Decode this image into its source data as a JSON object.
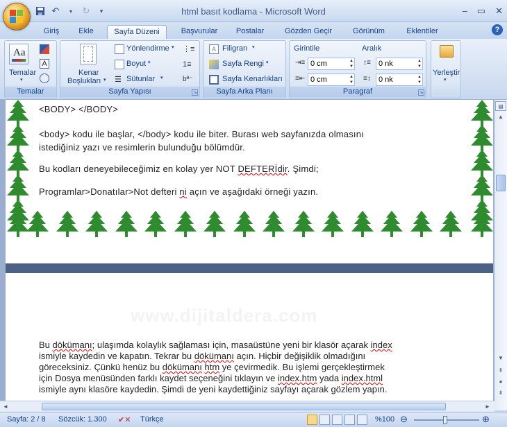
{
  "window": {
    "title": "html basıt kodlama - Microsoft Word",
    "controls": [
      "–",
      "▭",
      "✕"
    ]
  },
  "tabs": [
    "Giriş",
    "Ekle",
    "Sayfa Düzeni",
    "Başvurular",
    "Postalar",
    "Gözden Geçir",
    "Görünüm",
    "Eklentiler"
  ],
  "active_tab": "Sayfa Düzeni",
  "ribbon": {
    "temalar": {
      "label": "Temalar",
      "button": "Temalar"
    },
    "sayfa_yapisi": {
      "label": "Sayfa Yapısı",
      "kenar": "Kenar",
      "bosluklari": "Boşlukları",
      "yonlendirme": "Yönlendirme",
      "boyut": "Boyut",
      "sutunlar": "Sütunlar"
    },
    "sayfa_arka_plani": {
      "label": "Sayfa Arka Planı",
      "filigran": "Filigran",
      "sayfa_rengi": "Sayfa Rengi",
      "sayfa_kenarliklari": "Sayfa Kenarlıkları"
    },
    "paragraf": {
      "label": "Paragraf",
      "girintile": "Girintile",
      "aralik": "Aralık",
      "indent_left": "0 cm",
      "indent_right": "0 cm",
      "space_before": "0 nk",
      "space_after": "0 nk"
    },
    "yerlestir": {
      "label": "Yerleştir"
    }
  },
  "document": {
    "page1": {
      "l1": "<BODY> </BODY>",
      "l2": "<body> kodu ile başlar, </body> kodu ile biter. Burası web sayfanızda olmasını",
      "l3": "istediğiniz  yazı ve resimlerin bulunduğu bölümdür.",
      "l4a": "Bu kodları deneyebileceğimiz  en kolay yer NOT ",
      "l4b": "DEFTERİdir",
      "l4c": ". Şimdi;",
      "l5a": "Programlar>Donatılar>Not defteri ",
      "l5b": "ni",
      "l5c": " açın ve aşağıdaki örneği yazın."
    },
    "page2": {
      "watermark": "www.dijitaldera.com",
      "l1a": "Bu ",
      "l1b": "dökümanı",
      "l1c": "; ulaşımda kolaylık sağlaması için, masaüstüne yeni bir klasör açarak ",
      "l1d": "index",
      "l2a": "ismiyle kaydedin ve kapatın. Tekrar bu ",
      "l2b": "dökümanı",
      "l2c": " açın. Hiçbir değişiklik olmadığını",
      "l3a": "göreceksiniz. Çünkü henüz bu ",
      "l3b": "dökümanı",
      "l3c": " ",
      "l3d": "htm",
      "l3e": " ye çevirmedik. Bu işlemi gerçekleştirmek",
      "l4a": "için Dosya menüsünden farklı kaydet seçeneğini tıklayın ve ",
      "l4b": "index.htm",
      "l4c": " yada ",
      "l4d": "index.html",
      "l5": "ismiyle aynı klasöre kaydedin. Şimdi de yeni kaydettiğiniz sayfayı açarak gözlem yapın."
    }
  },
  "status": {
    "page": "Sayfa: 2 / 8",
    "words": "Sözcük: 1.300",
    "language": "Türkçe",
    "zoom": "%100"
  },
  "colors": {
    "tree": "#2e8b2e",
    "accent": "#15428b"
  }
}
